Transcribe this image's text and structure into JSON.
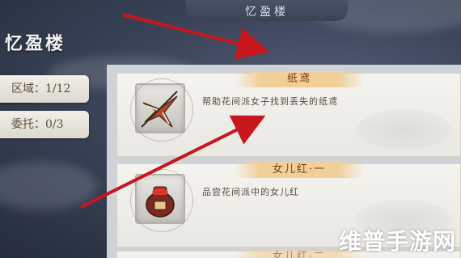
{
  "header": {
    "title": "忆盈楼"
  },
  "building": {
    "name": "忆盈楼"
  },
  "info": {
    "region": "区域：1/12",
    "commission": "委托：0/3"
  },
  "quests": [
    {
      "name": "纸鸢",
      "description": "帮助花间派女子找到丢失的纸鸢",
      "icon": "paper-kite-icon"
    },
    {
      "name": "女儿红·一",
      "description": "品尝花间派中的女儿红",
      "icon": "wine-jar-icon"
    },
    {
      "name": "女儿红·二",
      "description": "",
      "icon": ""
    }
  ],
  "colors": {
    "arrow": "#c8161d",
    "ribbon": "#f1cf98",
    "ribbon_text": "#7a3b12"
  },
  "watermark": "维普手游网"
}
